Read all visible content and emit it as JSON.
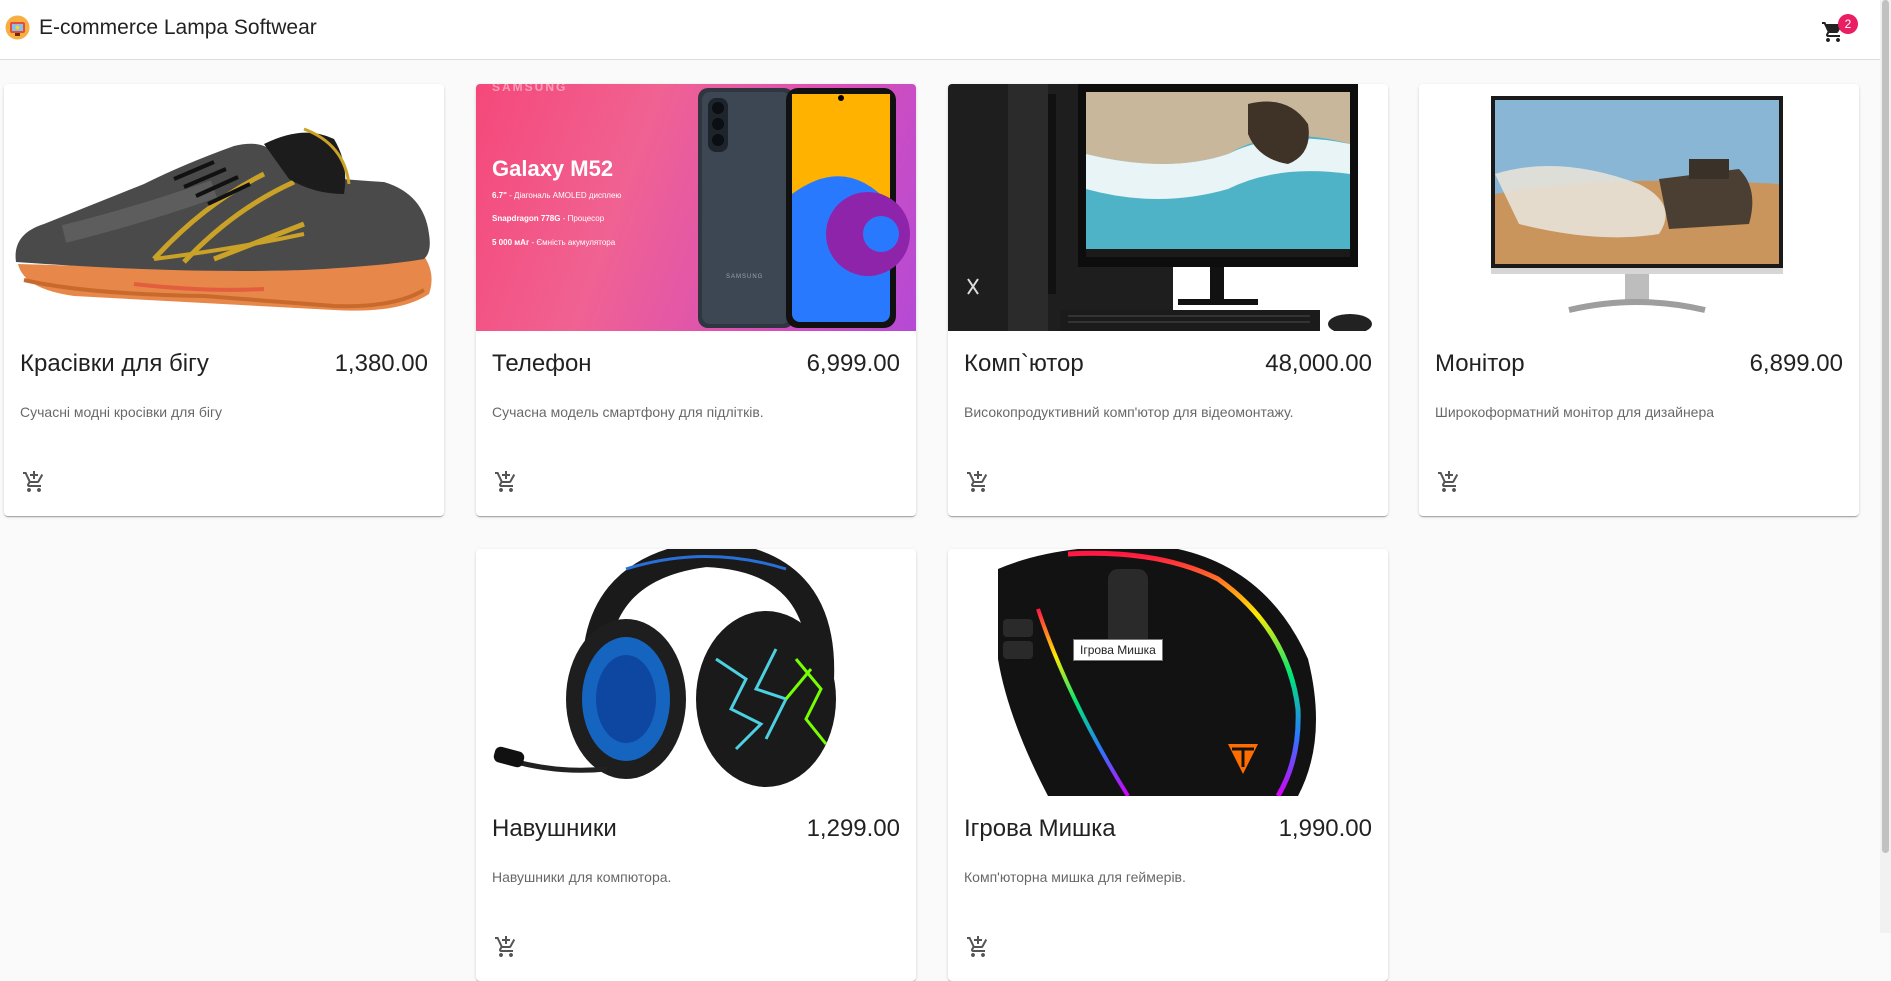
{
  "app": {
    "title": "E-commerce Lampa Softwear",
    "cart_count": "2"
  },
  "products": [
    {
      "name": "Красівки для бігу",
      "price": "1,380.00",
      "description": "Сучасні модні кросівки для бігу",
      "image_icon": "running-shoe-image"
    },
    {
      "name": "Телефон",
      "price": "6,999.00",
      "description": "Сучасна модель смартфону для підлітків.",
      "image_icon": "smartphone-image",
      "banner": {
        "brand": "SAMSUNG",
        "model": "Galaxy M52",
        "spec1_value": "6.7\"",
        "spec1_label": "- Діагональ AMOLED дисплею",
        "spec2_value": "Snapdragon 778G",
        "spec2_label": "- Процесор",
        "spec3_value": "5 000 мАг",
        "spec3_label": "- Ємність акумулятора",
        "phone_brand": "SAMSUNG"
      }
    },
    {
      "name": "Комп`ютор",
      "price": "48,000.00",
      "description": "Високопродуктивний комп'ютор для відеомонтажу.",
      "image_icon": "desktop-computer-image"
    },
    {
      "name": "Монітор",
      "price": "6,899.00",
      "description": "Широкоформатний монітор для дизайнера",
      "image_icon": "monitor-image"
    },
    {
      "name": "Навушники",
      "price": "1,299.00",
      "description": "Навушники для компютора.",
      "image_icon": "headphones-image"
    },
    {
      "name": "Ігрова Мишка",
      "price": "1,990.00",
      "description": "Комп'юторна мишка для геймерів.",
      "image_icon": "gaming-mouse-image"
    }
  ],
  "tooltip": {
    "text": "Ігрова Мишка"
  },
  "colors": {
    "badge": "#e91e63",
    "appbar": "#ffffff",
    "background": "#fafafa"
  }
}
